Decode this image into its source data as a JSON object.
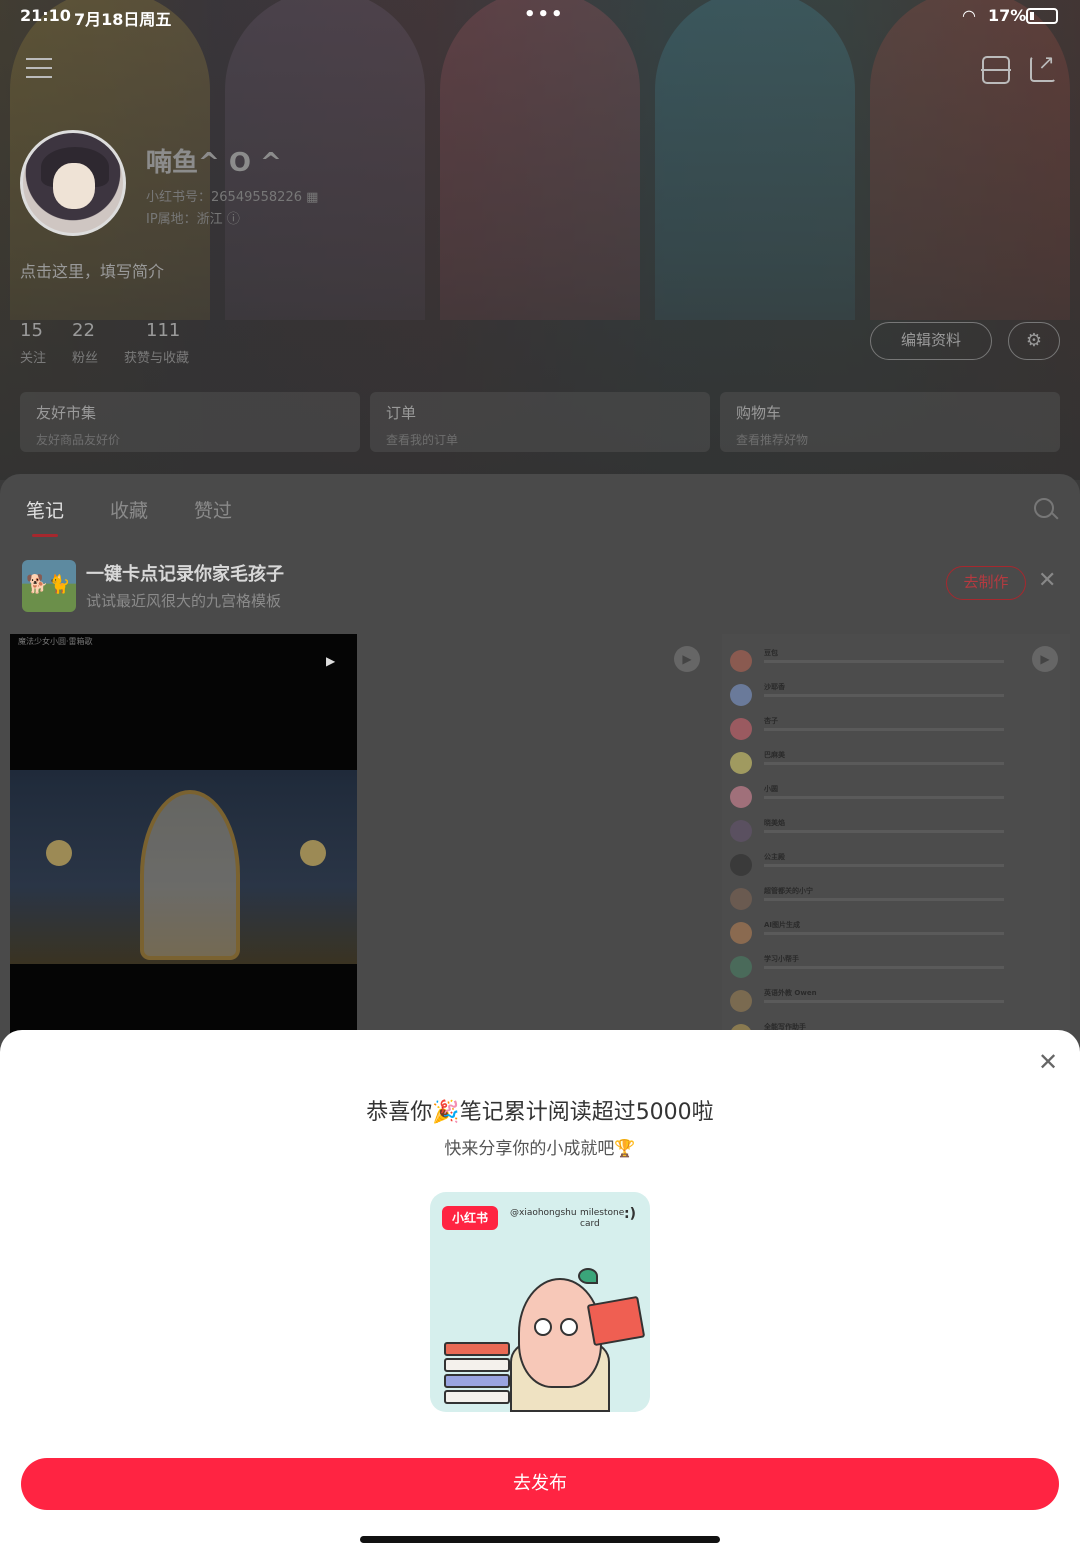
{
  "status_bar": {
    "time": "21:10",
    "date": "7月18日周五",
    "battery": "17%"
  },
  "profile": {
    "nickname": "喃鱼^ O ^",
    "redbook_id": "小红书号：26549558226",
    "ip_location": "IP属地：浙江",
    "bio": "点击这里，填写简介",
    "stats": [
      {
        "value": "15",
        "label": "关注"
      },
      {
        "value": "22",
        "label": "粉丝"
      },
      {
        "value": "111",
        "label": "获赞与收藏"
      }
    ],
    "edit_button": "编辑资料"
  },
  "cards": [
    {
      "title": "友好市集",
      "subtitle": "友好商品友好价"
    },
    {
      "title": "订单",
      "subtitle": "查看我的订单"
    },
    {
      "title": "购物车",
      "subtitle": "查看推荐好物"
    }
  ],
  "tabs": [
    "笔记",
    "收藏",
    "赞过"
  ],
  "promo": {
    "title": "一键卡点记录你家毛孩子",
    "subtitle": "试试最近风很大的九宫格模板",
    "button": "去制作"
  },
  "note1": {
    "header": "魔法少女小圆·雷箱歌"
  },
  "note2_chats": [
    {
      "name": "豆包"
    },
    {
      "name": "沙耶香"
    },
    {
      "name": "杏子"
    },
    {
      "name": "巴麻美"
    },
    {
      "name": "小圆"
    },
    {
      "name": "晓美焰"
    },
    {
      "name": "公主殿"
    },
    {
      "name": "超管都关的小宁"
    },
    {
      "name": "AI图片生成"
    },
    {
      "name": "学习小帮手"
    },
    {
      "name": "英语外教 Owen"
    },
    {
      "name": "全能写作助手"
    }
  ],
  "sheet": {
    "title": "恭喜你🎉笔记累计阅读超过5000啦",
    "subtitle": "快来分享你的小成就吧🏆",
    "card": {
      "logo": "小红书",
      "handle": "@xiaohongshu",
      "milestone_line1": "milestone",
      "milestone_line2": "card",
      "smile": ":)"
    },
    "publish_button": "去发布"
  }
}
